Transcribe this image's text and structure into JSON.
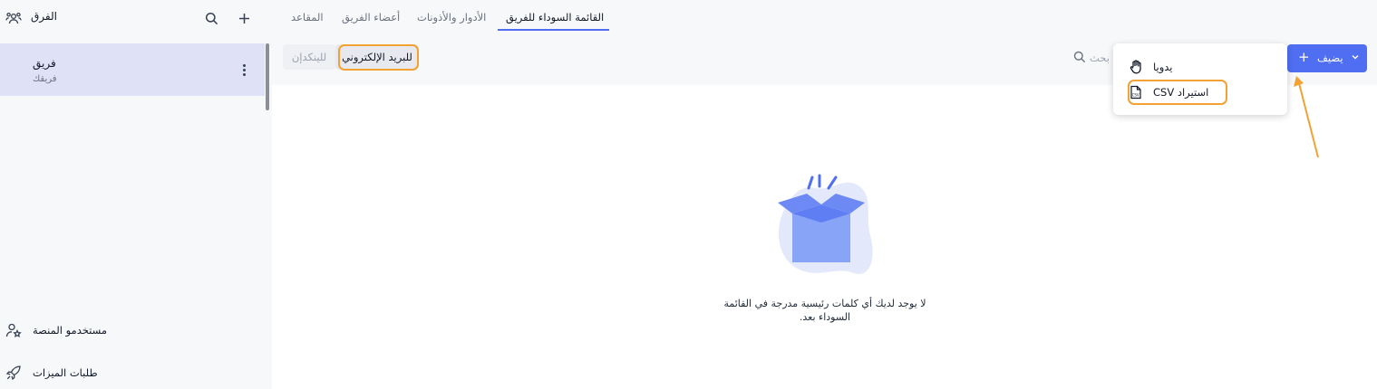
{
  "sidebar": {
    "title": "الفرق",
    "team": {
      "name": "فريق",
      "subtitle": "فريقك"
    },
    "footer": {
      "platform_users": "مستخدمو المنصة",
      "feature_requests": "طلبات الميزات"
    }
  },
  "topnav": {
    "tabs": [
      {
        "label": "القائمة السوداء للفريق",
        "active": true
      },
      {
        "label": "الأدوار والأذونات",
        "active": false
      },
      {
        "label": "أعضاء الفريق",
        "active": false
      },
      {
        "label": "المقاعد",
        "active": false
      }
    ]
  },
  "toolbar": {
    "filter_email": "للبريد الإلكتروني",
    "filter_linkedin": "للينكدإن",
    "search_placeholder": "بحث",
    "add_label": "يضيف"
  },
  "add_menu": {
    "items": [
      {
        "label": "يدويا",
        "icon": "hand-icon"
      },
      {
        "label": "CSV استيراد",
        "icon": "csv-file-icon",
        "highlighted": true
      }
    ]
  },
  "empty_state": {
    "line1": "لا يوجد لديك أي كلمات رئيسية مدرجة في القائمة",
    "line2": "السوداء بعد."
  },
  "colors": {
    "accent": "#4f6ef2",
    "highlight": "#f2a132",
    "selected_bg": "#dfe2f7"
  }
}
